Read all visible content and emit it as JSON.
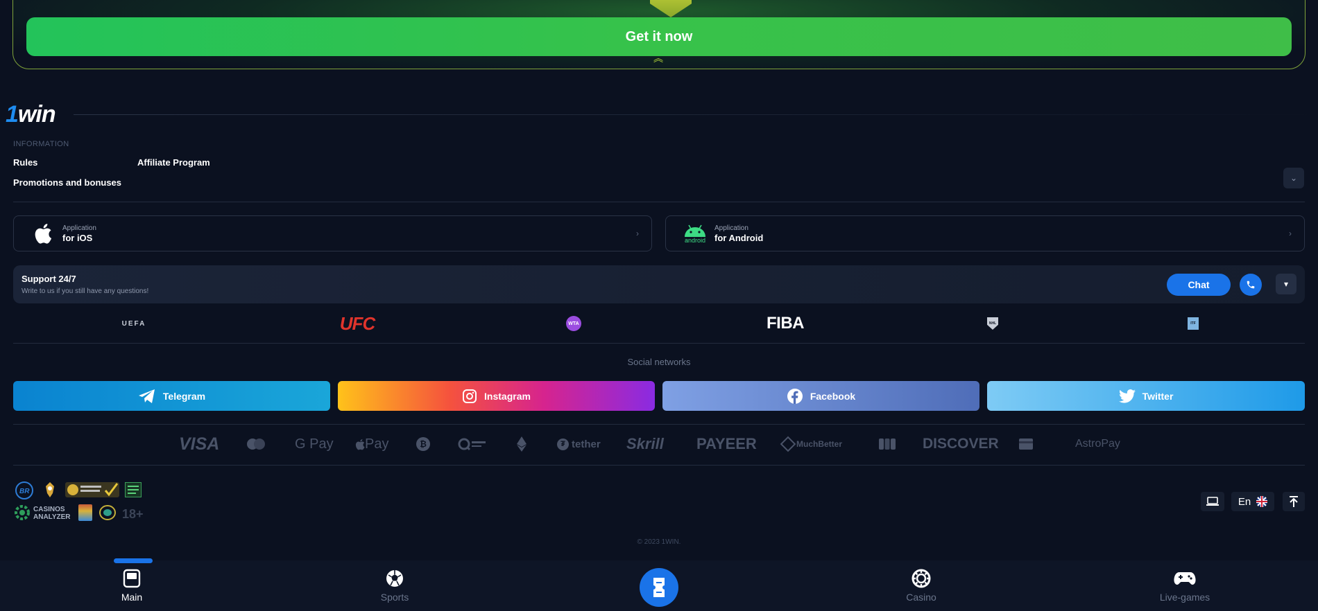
{
  "banner": {
    "cta_label": "Get it now"
  },
  "brand": {
    "logo_one": "1",
    "logo_win": "win"
  },
  "info": {
    "heading": "INFORMATION",
    "links": [
      "Rules",
      "Affiliate Program",
      "Promotions and bonuses"
    ]
  },
  "apps": [
    {
      "line1": "Application",
      "line2": "for iOS",
      "icon": "apple-icon"
    },
    {
      "line1": "Application",
      "line2": "for Android",
      "icon": "android-icon",
      "icon_caption": "android"
    }
  ],
  "support": {
    "title": "Support 24/7",
    "subtitle": "Write to us if you still have any questions!",
    "chat_label": "Chat"
  },
  "partners": [
    "UEFA",
    "UFC",
    "WTA",
    "FIBA",
    "NHL",
    "ITF"
  ],
  "social": {
    "heading": "Social networks",
    "items": [
      {
        "label": "Telegram",
        "icon": "telegram-icon"
      },
      {
        "label": "Instagram",
        "icon": "instagram-icon"
      },
      {
        "label": "Facebook",
        "icon": "facebook-icon"
      },
      {
        "label": "Twitter",
        "icon": "twitter-icon"
      }
    ]
  },
  "payments": [
    "VISA",
    "G Pay",
    "Pay",
    "tether",
    "Skrill",
    "PAYEER",
    "MuchBetter",
    "DISCOVER",
    "AstroPay"
  ],
  "licenses": {
    "casinos_analyzer": "CASINOS ANALYZER",
    "age": "18+"
  },
  "controls": {
    "language": "En"
  },
  "footer": {
    "copyright": "© 2023 1WIN."
  },
  "nav": {
    "items": [
      "Main",
      "Sports",
      "Casino",
      "Live-games"
    ],
    "active": "Main"
  },
  "colors": {
    "accent": "#1a73e8",
    "cta": "#2fc24f",
    "background": "#0b1120"
  }
}
